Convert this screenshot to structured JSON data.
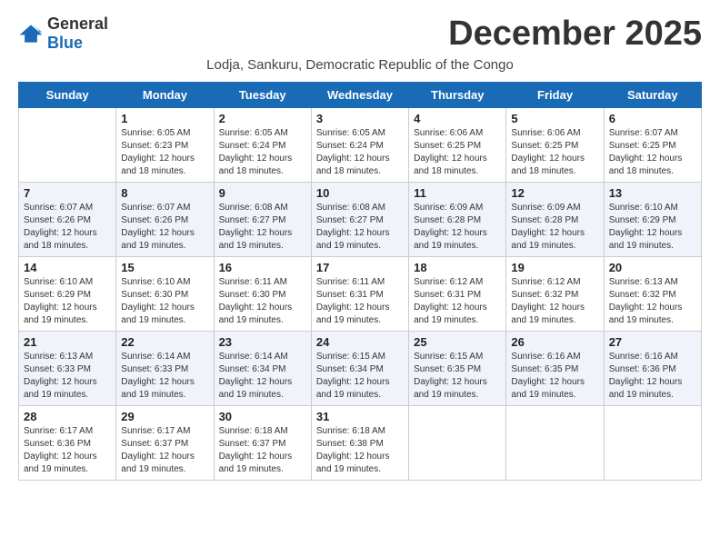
{
  "logo": {
    "general": "General",
    "blue": "Blue"
  },
  "header": {
    "month_year": "December 2025",
    "subtitle": "Lodja, Sankuru, Democratic Republic of the Congo"
  },
  "weekdays": [
    "Sunday",
    "Monday",
    "Tuesday",
    "Wednesday",
    "Thursday",
    "Friday",
    "Saturday"
  ],
  "weeks": [
    [
      {
        "day": "",
        "sunrise": "",
        "sunset": "",
        "daylight": ""
      },
      {
        "day": "1",
        "sunrise": "Sunrise: 6:05 AM",
        "sunset": "Sunset: 6:23 PM",
        "daylight": "Daylight: 12 hours and 18 minutes."
      },
      {
        "day": "2",
        "sunrise": "Sunrise: 6:05 AM",
        "sunset": "Sunset: 6:24 PM",
        "daylight": "Daylight: 12 hours and 18 minutes."
      },
      {
        "day": "3",
        "sunrise": "Sunrise: 6:05 AM",
        "sunset": "Sunset: 6:24 PM",
        "daylight": "Daylight: 12 hours and 18 minutes."
      },
      {
        "day": "4",
        "sunrise": "Sunrise: 6:06 AM",
        "sunset": "Sunset: 6:25 PM",
        "daylight": "Daylight: 12 hours and 18 minutes."
      },
      {
        "day": "5",
        "sunrise": "Sunrise: 6:06 AM",
        "sunset": "Sunset: 6:25 PM",
        "daylight": "Daylight: 12 hours and 18 minutes."
      },
      {
        "day": "6",
        "sunrise": "Sunrise: 6:07 AM",
        "sunset": "Sunset: 6:25 PM",
        "daylight": "Daylight: 12 hours and 18 minutes."
      }
    ],
    [
      {
        "day": "7",
        "sunrise": "Sunrise: 6:07 AM",
        "sunset": "Sunset: 6:26 PM",
        "daylight": "Daylight: 12 hours and 18 minutes."
      },
      {
        "day": "8",
        "sunrise": "Sunrise: 6:07 AM",
        "sunset": "Sunset: 6:26 PM",
        "daylight": "Daylight: 12 hours and 19 minutes."
      },
      {
        "day": "9",
        "sunrise": "Sunrise: 6:08 AM",
        "sunset": "Sunset: 6:27 PM",
        "daylight": "Daylight: 12 hours and 19 minutes."
      },
      {
        "day": "10",
        "sunrise": "Sunrise: 6:08 AM",
        "sunset": "Sunset: 6:27 PM",
        "daylight": "Daylight: 12 hours and 19 minutes."
      },
      {
        "day": "11",
        "sunrise": "Sunrise: 6:09 AM",
        "sunset": "Sunset: 6:28 PM",
        "daylight": "Daylight: 12 hours and 19 minutes."
      },
      {
        "day": "12",
        "sunrise": "Sunrise: 6:09 AM",
        "sunset": "Sunset: 6:28 PM",
        "daylight": "Daylight: 12 hours and 19 minutes."
      },
      {
        "day": "13",
        "sunrise": "Sunrise: 6:10 AM",
        "sunset": "Sunset: 6:29 PM",
        "daylight": "Daylight: 12 hours and 19 minutes."
      }
    ],
    [
      {
        "day": "14",
        "sunrise": "Sunrise: 6:10 AM",
        "sunset": "Sunset: 6:29 PM",
        "daylight": "Daylight: 12 hours and 19 minutes."
      },
      {
        "day": "15",
        "sunrise": "Sunrise: 6:10 AM",
        "sunset": "Sunset: 6:30 PM",
        "daylight": "Daylight: 12 hours and 19 minutes."
      },
      {
        "day": "16",
        "sunrise": "Sunrise: 6:11 AM",
        "sunset": "Sunset: 6:30 PM",
        "daylight": "Daylight: 12 hours and 19 minutes."
      },
      {
        "day": "17",
        "sunrise": "Sunrise: 6:11 AM",
        "sunset": "Sunset: 6:31 PM",
        "daylight": "Daylight: 12 hours and 19 minutes."
      },
      {
        "day": "18",
        "sunrise": "Sunrise: 6:12 AM",
        "sunset": "Sunset: 6:31 PM",
        "daylight": "Daylight: 12 hours and 19 minutes."
      },
      {
        "day": "19",
        "sunrise": "Sunrise: 6:12 AM",
        "sunset": "Sunset: 6:32 PM",
        "daylight": "Daylight: 12 hours and 19 minutes."
      },
      {
        "day": "20",
        "sunrise": "Sunrise: 6:13 AM",
        "sunset": "Sunset: 6:32 PM",
        "daylight": "Daylight: 12 hours and 19 minutes."
      }
    ],
    [
      {
        "day": "21",
        "sunrise": "Sunrise: 6:13 AM",
        "sunset": "Sunset: 6:33 PM",
        "daylight": "Daylight: 12 hours and 19 minutes."
      },
      {
        "day": "22",
        "sunrise": "Sunrise: 6:14 AM",
        "sunset": "Sunset: 6:33 PM",
        "daylight": "Daylight: 12 hours and 19 minutes."
      },
      {
        "day": "23",
        "sunrise": "Sunrise: 6:14 AM",
        "sunset": "Sunset: 6:34 PM",
        "daylight": "Daylight: 12 hours and 19 minutes."
      },
      {
        "day": "24",
        "sunrise": "Sunrise: 6:15 AM",
        "sunset": "Sunset: 6:34 PM",
        "daylight": "Daylight: 12 hours and 19 minutes."
      },
      {
        "day": "25",
        "sunrise": "Sunrise: 6:15 AM",
        "sunset": "Sunset: 6:35 PM",
        "daylight": "Daylight: 12 hours and 19 minutes."
      },
      {
        "day": "26",
        "sunrise": "Sunrise: 6:16 AM",
        "sunset": "Sunset: 6:35 PM",
        "daylight": "Daylight: 12 hours and 19 minutes."
      },
      {
        "day": "27",
        "sunrise": "Sunrise: 6:16 AM",
        "sunset": "Sunset: 6:36 PM",
        "daylight": "Daylight: 12 hours and 19 minutes."
      }
    ],
    [
      {
        "day": "28",
        "sunrise": "Sunrise: 6:17 AM",
        "sunset": "Sunset: 6:36 PM",
        "daylight": "Daylight: 12 hours and 19 minutes."
      },
      {
        "day": "29",
        "sunrise": "Sunrise: 6:17 AM",
        "sunset": "Sunset: 6:37 PM",
        "daylight": "Daylight: 12 hours and 19 minutes."
      },
      {
        "day": "30",
        "sunrise": "Sunrise: 6:18 AM",
        "sunset": "Sunset: 6:37 PM",
        "daylight": "Daylight: 12 hours and 19 minutes."
      },
      {
        "day": "31",
        "sunrise": "Sunrise: 6:18 AM",
        "sunset": "Sunset: 6:38 PM",
        "daylight": "Daylight: 12 hours and 19 minutes."
      },
      {
        "day": "",
        "sunrise": "",
        "sunset": "",
        "daylight": ""
      },
      {
        "day": "",
        "sunrise": "",
        "sunset": "",
        "daylight": ""
      },
      {
        "day": "",
        "sunrise": "",
        "sunset": "",
        "daylight": ""
      }
    ]
  ]
}
